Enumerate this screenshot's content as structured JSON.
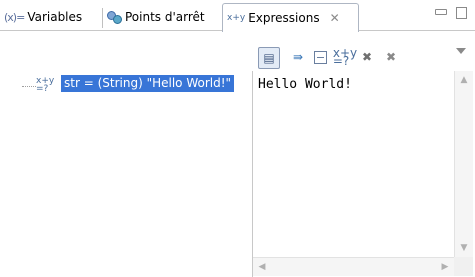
{
  "tabs": [
    {
      "label": "Variables",
      "icon": "variables-icon",
      "icon_glyph": "(x)="
    },
    {
      "label": "Points d'arrêt",
      "icon": "breakpoints-icon"
    },
    {
      "label": "Expressions",
      "icon": "expressions-icon",
      "icon_glyph": "x+y",
      "active": true,
      "close_glyph": "✕"
    }
  ],
  "toolbar": {
    "menu_icon": "view-menu-icon"
  },
  "tree": {
    "rows": [
      {
        "icon": "watch-expression-icon",
        "icon_glyph": "x+y",
        "label": "str = (String) \"Hello World!\"",
        "selected": true
      }
    ]
  },
  "detail": {
    "text": "Hello World!"
  },
  "colors": {
    "selection": "#3875d7",
    "tab_border": "#aeb6c3"
  }
}
